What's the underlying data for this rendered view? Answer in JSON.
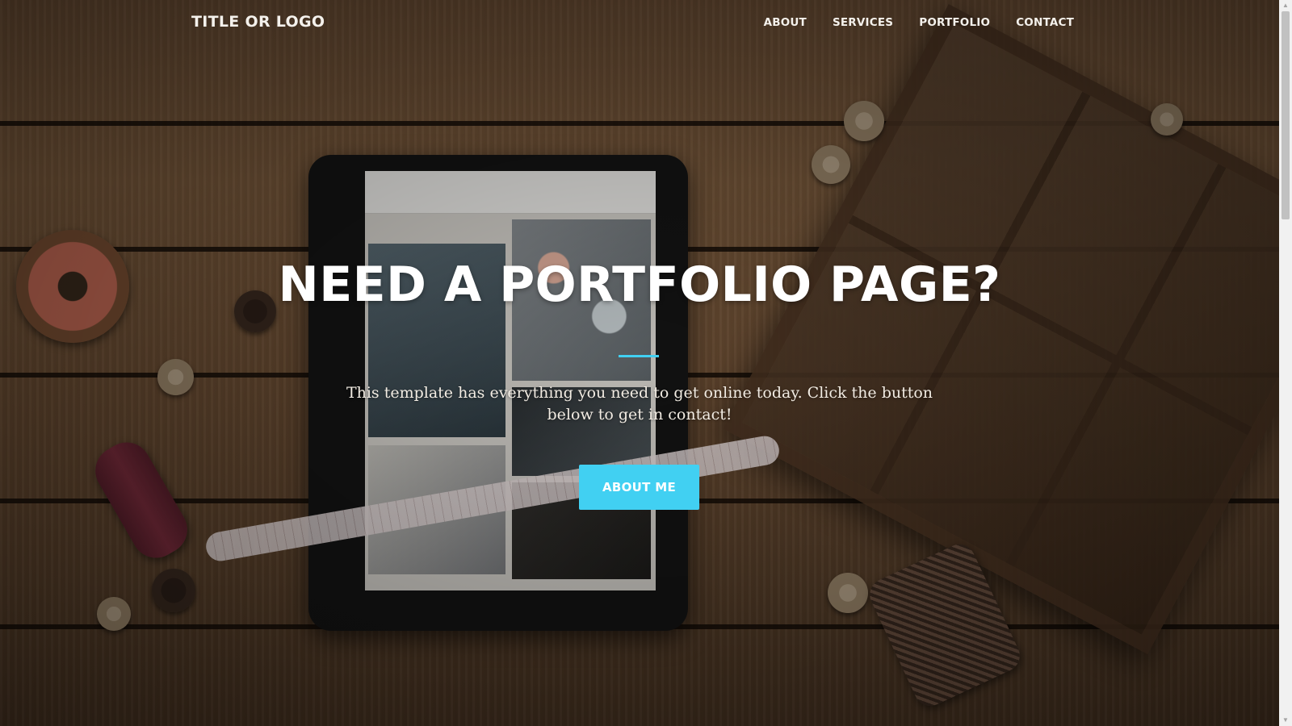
{
  "navbar": {
    "brand": "TITLE OR LOGO",
    "links": [
      {
        "label": "ABOUT"
      },
      {
        "label": "SERVICES"
      },
      {
        "label": "PORTFOLIO"
      },
      {
        "label": "CONTACT"
      }
    ]
  },
  "hero": {
    "title": "NEED A PORTFOLIO PAGE?",
    "text": "This template has everything you need to get online today. Click the button below to get in contact!",
    "cta_label": "ABOUT ME",
    "background_image": "wooden table with tablet, sewing tools and buttons"
  },
  "colors": {
    "accent": "#41d0f2",
    "text": "#ffffff"
  },
  "icons": {
    "scroll_up": "arrow-up-icon",
    "scroll_down": "arrow-down-icon"
  }
}
